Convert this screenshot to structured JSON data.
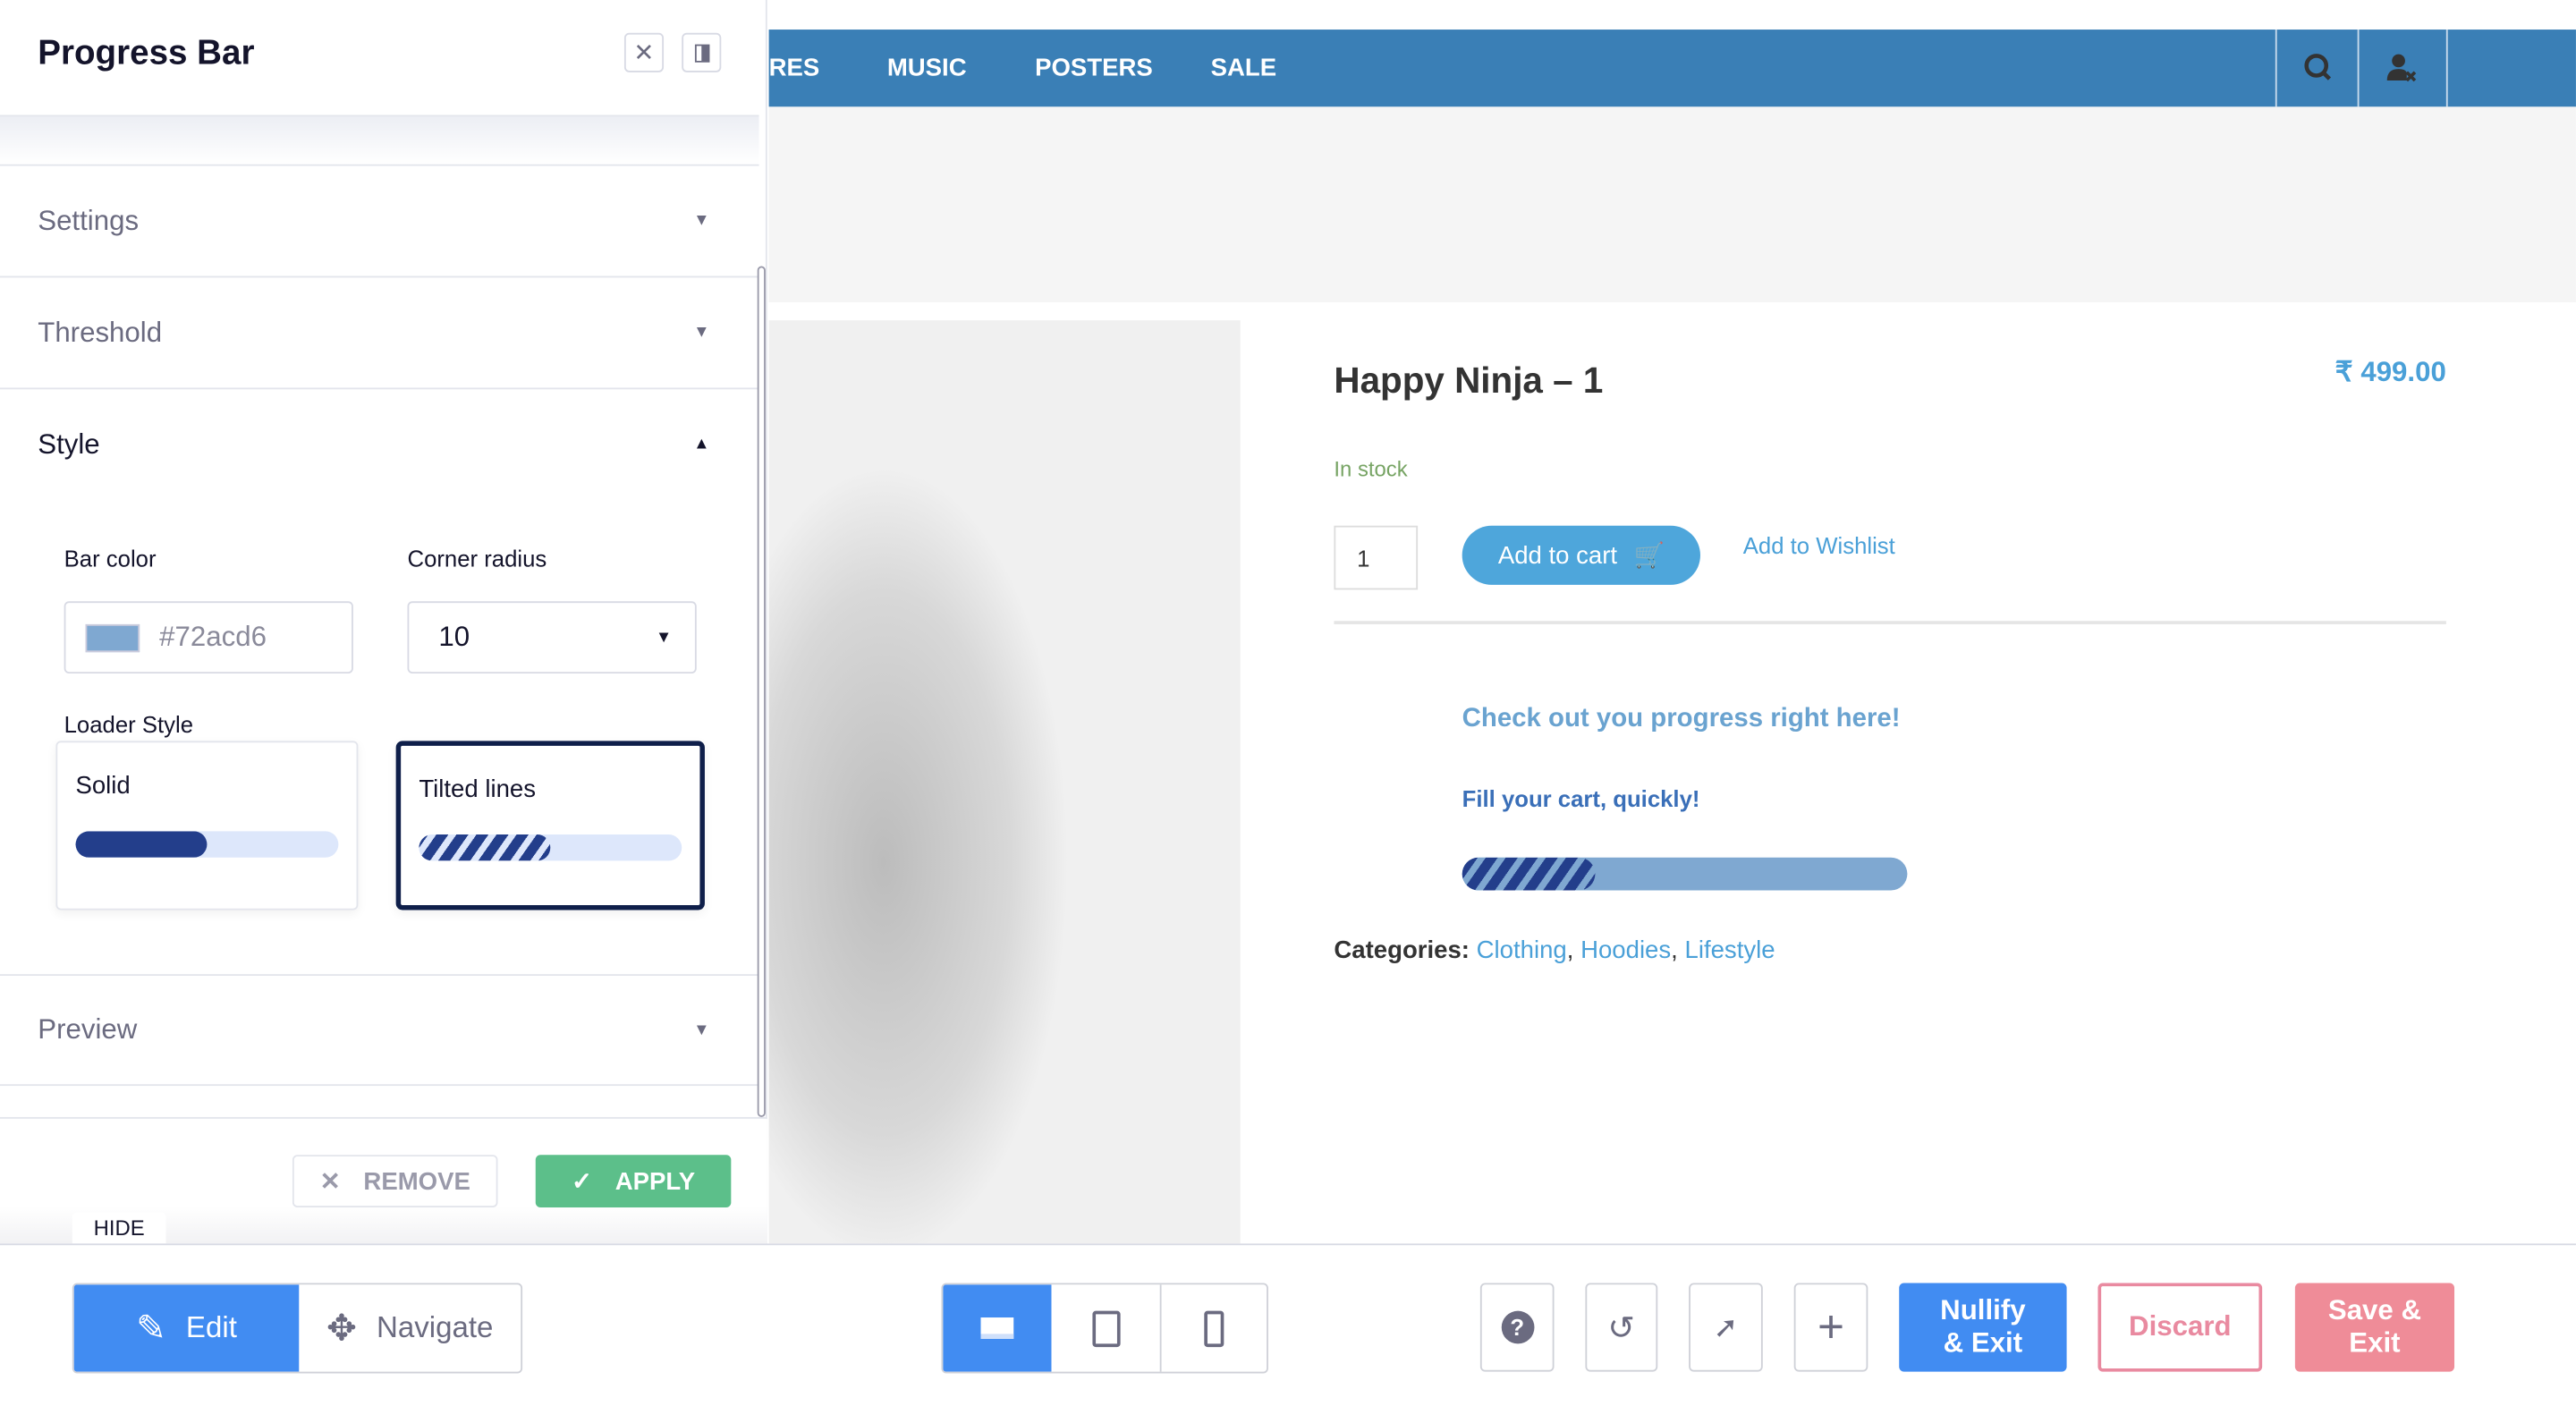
{
  "panel": {
    "title": "Progress Bar",
    "sections": {
      "settings": "Settings",
      "threshold": "Threshold",
      "style": "Style",
      "preview": "Preview"
    },
    "style": {
      "bar_color_label": "Bar color",
      "bar_color_value": "#72acd6",
      "bar_color_swatch": "#7fa8d1",
      "corner_radius_label": "Corner radius",
      "corner_radius_value": "10",
      "loader_style_label": "Loader Style",
      "loaders": [
        {
          "label": "Solid",
          "progress": 0.5,
          "selected": false
        },
        {
          "label": "Tilted lines",
          "progress": 0.5,
          "selected": true
        }
      ]
    },
    "remove_label": "REMOVE",
    "apply_label": "APPLY",
    "hide_label": "HIDE"
  },
  "nav": {
    "items": [
      "RES",
      "MUSIC",
      "POSTERS",
      "SALE"
    ],
    "color": "#3a7fb6"
  },
  "product": {
    "title": "Happy Ninja – 1",
    "price": "₹ 499.00",
    "stock": "In stock",
    "quantity": "1",
    "add_to_cart": "Add to cart",
    "wishlist": "Add to Wishlist",
    "progress_heading": "Check out you progress right here!",
    "progress_sub": "Fill your cart, quickly!",
    "progress": 0.3,
    "categories_label": "Categories:",
    "categories": [
      "Clothing",
      "Hoodies",
      "Lifestyle"
    ]
  },
  "toolbar": {
    "edit": "Edit",
    "navigate": "Navigate",
    "nullify": "Nullify & Exit",
    "discard": "Discard",
    "save": "Save & Exit",
    "colors": {
      "primary": "#418cf2",
      "discard": "#e98aa0",
      "save": "#ef8c98",
      "apply": "#5cbf8a"
    }
  }
}
